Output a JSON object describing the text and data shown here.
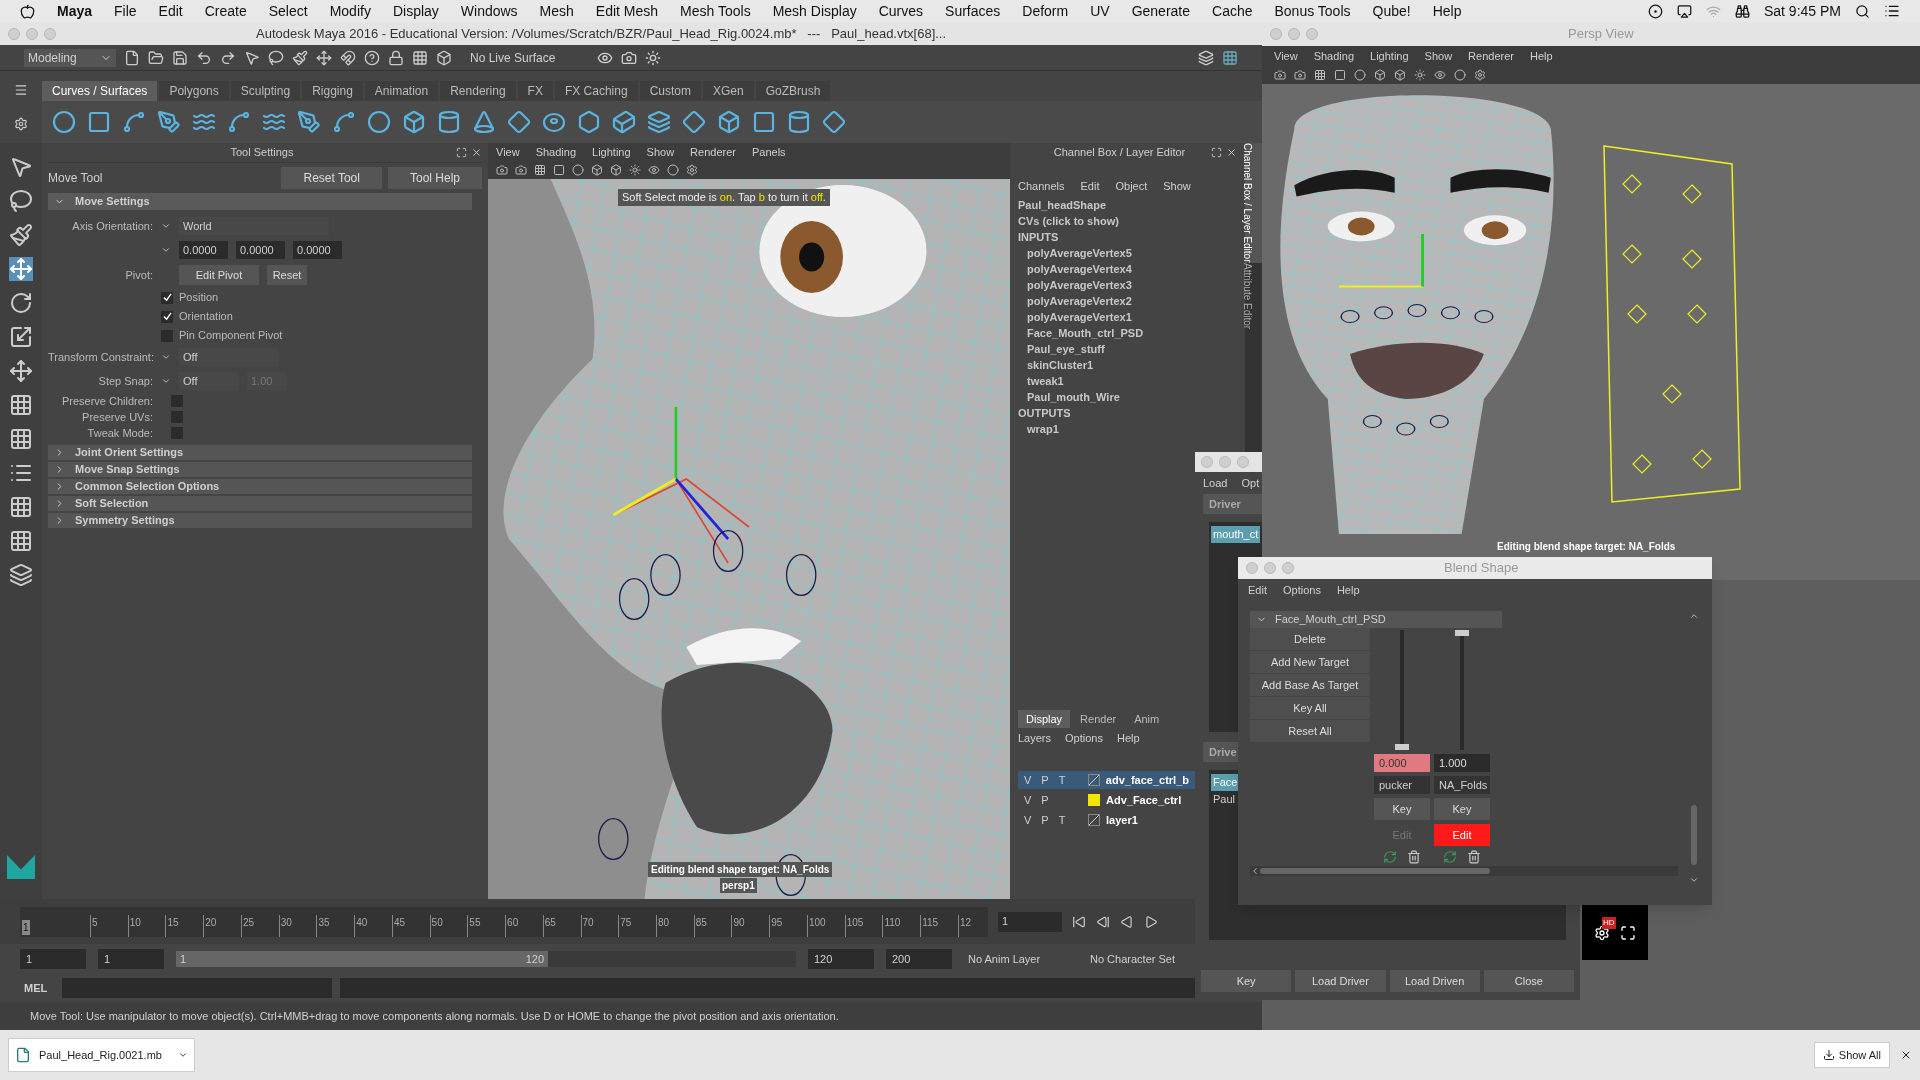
{
  "mac_menu": {
    "app": "Maya",
    "items": [
      "File",
      "Edit",
      "Create",
      "Select",
      "Modify",
      "Display",
      "Windows",
      "Mesh",
      "Edit Mesh",
      "Mesh Tools",
      "Mesh Display",
      "Curves",
      "Surfaces",
      "Deform",
      "UV",
      "Generate",
      "Cache",
      "Bonus Tools",
      "Qube!",
      "Help"
    ],
    "clock": "Sat 9:45 PM"
  },
  "maya_window": {
    "title": "Autodesk Maya 2016 - Educational Version: /Volumes/Scratch/BZR/Paul_Head_Rig.0024.mb*   ---   Paul_head.vtx[68]..."
  },
  "toolbar": {
    "mode": "Modeling",
    "live_surface": "No Live Surface"
  },
  "shelf": {
    "tabs": [
      {
        "label": "Curves / Surfaces",
        "selected": true
      },
      {
        "label": "Polygons",
        "selected": false
      },
      {
        "label": "Sculpting",
        "selected": false
      },
      {
        "label": "Rigging",
        "selected": false
      },
      {
        "label": "Animation",
        "selected": false
      },
      {
        "label": "Rendering",
        "selected": false
      },
      {
        "label": "FX",
        "selected": false
      },
      {
        "label": "FX Caching",
        "selected": false
      },
      {
        "label": "Custom",
        "selected": false
      },
      {
        "label": "XGen",
        "selected": false
      },
      {
        "label": "GoZBrush",
        "selected": false
      }
    ]
  },
  "tool_settings": {
    "title": "Tool Settings",
    "tool": "Move Tool",
    "buttons": [
      "Reset Tool",
      "Tool Help"
    ],
    "section": "Move Settings",
    "axis_label": "Axis Orientation:",
    "axis_value": "World",
    "axis_values": [
      "0.0000",
      "0.0000",
      "0.0000"
    ],
    "pivot_label": "Pivot:",
    "pivot_buttons": [
      "Edit Pivot",
      "Reset"
    ],
    "pivot_options": [
      {
        "label": "Position",
        "checked": true
      },
      {
        "label": "Orientation",
        "checked": true
      },
      {
        "label": "Pin Component Pivot",
        "checked": false
      }
    ],
    "constraint_label": "Transform Constraint:",
    "constraint_value": "Off",
    "snap_label": "Step Snap:",
    "snap_value": "Off",
    "snap_step": "1.00",
    "preserve": [
      {
        "label": "Preserve Children:",
        "checked": false
      },
      {
        "label": "Preserve UVs:",
        "checked": false
      },
      {
        "label": "Tweak Mode:",
        "checked": false
      }
    ],
    "collapsed_sections": [
      "Joint Orient Settings",
      "Move Snap Settings",
      "Common Selection Options",
      "Soft Selection",
      "Symmetry Settings"
    ]
  },
  "viewport": {
    "menus": [
      "View",
      "Shading",
      "Lighting",
      "Show",
      "Renderer",
      "Panels"
    ],
    "message": [
      {
        "text": "Soft Select mode is ",
        "highlight": false
      },
      {
        "text": "on",
        "highlight": true
      },
      {
        "text": ". Tap ",
        "highlight": false
      },
      {
        "text": "b",
        "highlight": true
      },
      {
        "text": " to turn it ",
        "highlight": false
      },
      {
        "text": "off",
        "highlight": true
      },
      {
        "text": ".",
        "highlight": false
      }
    ],
    "status": "Editing blend shape target: NA_Folds",
    "camera": "persp1"
  },
  "channel_box": {
    "title": "Channel Box / Layer Editor",
    "menus": [
      "Channels",
      "Edit",
      "Object",
      "Show"
    ],
    "items": [
      {
        "label": "Paul_headShape"
      },
      {
        "label": "CVs (click to show)"
      },
      {
        "label": "INPUTS",
        "children": [
          {
            "label": "polyAverageVertex5"
          },
          {
            "label": "polyAverageVertex4"
          },
          {
            "label": "polyAverageVertex3"
          },
          {
            "label": "polyAverageVertex2"
          },
          {
            "label": "polyAverageVertex1"
          },
          {
            "label": "Face_Mouth_ctrl_PSD"
          },
          {
            "label": "Paul_eye_stuff"
          },
          {
            "label": "skinCluster1"
          },
          {
            "label": "tweak1"
          },
          {
            "label": "Paul_mouth_Wire"
          }
        ]
      },
      {
        "label": "OUTPUTS",
        "children": [
          {
            "label": "wrap1"
          }
        ]
      }
    ]
  },
  "layer_editor": {
    "tabs": [
      {
        "label": "Display",
        "selected": true
      },
      {
        "label": "Render",
        "selected": false
      },
      {
        "label": "Anim",
        "selected": false
      }
    ],
    "menus": [
      "Layers",
      "Options",
      "Help"
    ],
    "layers": [
      {
        "flags": [
          "V",
          "P",
          "T"
        ],
        "name": "adv_face_ctrl_b",
        "selected": true
      },
      {
        "flags": [
          "V",
          "P"
        ],
        "name": "Adv_Face_ctrl",
        "selected": false,
        "color": "#f2e600"
      },
      {
        "flags": [
          "V",
          "P",
          "T"
        ],
        "name": "layer1",
        "selected": false
      }
    ]
  },
  "side_tabs": [
    {
      "label": "Channel Box / Layer Editor",
      "selected": true
    },
    {
      "label": "Attribute Editor",
      "selected": false
    }
  ],
  "timeline": {
    "playhead": "1",
    "ticks": [
      "5",
      "10",
      "15",
      "20",
      "25",
      "30",
      "35",
      "40",
      "45",
      "50",
      "55",
      "60",
      "65",
      "70",
      "75",
      "80",
      "85",
      "90",
      "95",
      "100",
      "105",
      "110",
      "115",
      "12"
    ],
    "current_frame": "1"
  },
  "range": {
    "level": 0.6,
    "start": "1",
    "playback_start": "1",
    "slider_start": "1",
    "slider_end": "120",
    "playback_end": "120",
    "end": "200",
    "anim_layer": "No Anim Layer",
    "character_set": "No Character Set"
  },
  "command_line": {
    "label": "MEL"
  },
  "help_line": "Move Tool: Use manipulator to move object(s). Ctrl+MMB+drag to move components along normals. Use D or HOME to change the pivot position and axis orientation.",
  "persp_window": {
    "title": "Persp View",
    "menus": [
      "View",
      "Shading",
      "Lighting",
      "Show",
      "Renderer",
      "Help"
    ],
    "status": "Editing blend shape target: NA_Folds"
  },
  "driven_key_window": {
    "menus": [
      "Load",
      "Opt"
    ],
    "driver_header": "Driver",
    "driver_items": [
      {
        "label": "mouth_ct",
        "selected": true
      }
    ],
    "driven_header": "Drive",
    "driven_items": [
      {
        "label": "Face",
        "selected": true
      },
      {
        "label": "Paul",
        "selected": false
      }
    ],
    "buttons": [
      "Key",
      "Load Driver",
      "Load Driven",
      "Close"
    ]
  },
  "blend_shape": {
    "title": "Blend Shape",
    "menus": [
      "Edit",
      "Options",
      "Help"
    ],
    "group": "Face_Mouth_ctrl_PSD",
    "actions": [
      "Delete",
      "Add New Target",
      "Add Base As Target",
      "Key All",
      "Reset All"
    ],
    "targets": [
      {
        "value": "0.000",
        "name": "pucker",
        "level": 0,
        "keyed": true,
        "editing": false,
        "key_label": "Key",
        "edit_label": "Edit"
      },
      {
        "value": "1.000",
        "name": "NA_Folds",
        "level": 1,
        "keyed": false,
        "editing": true,
        "key_label": "Key",
        "edit_label": "Edit"
      }
    ]
  },
  "video_overlay": {
    "badge": "HD"
  },
  "taskbar": {
    "file": "Paul_Head_Rig.0021.mb",
    "show_all": "Show All"
  }
}
